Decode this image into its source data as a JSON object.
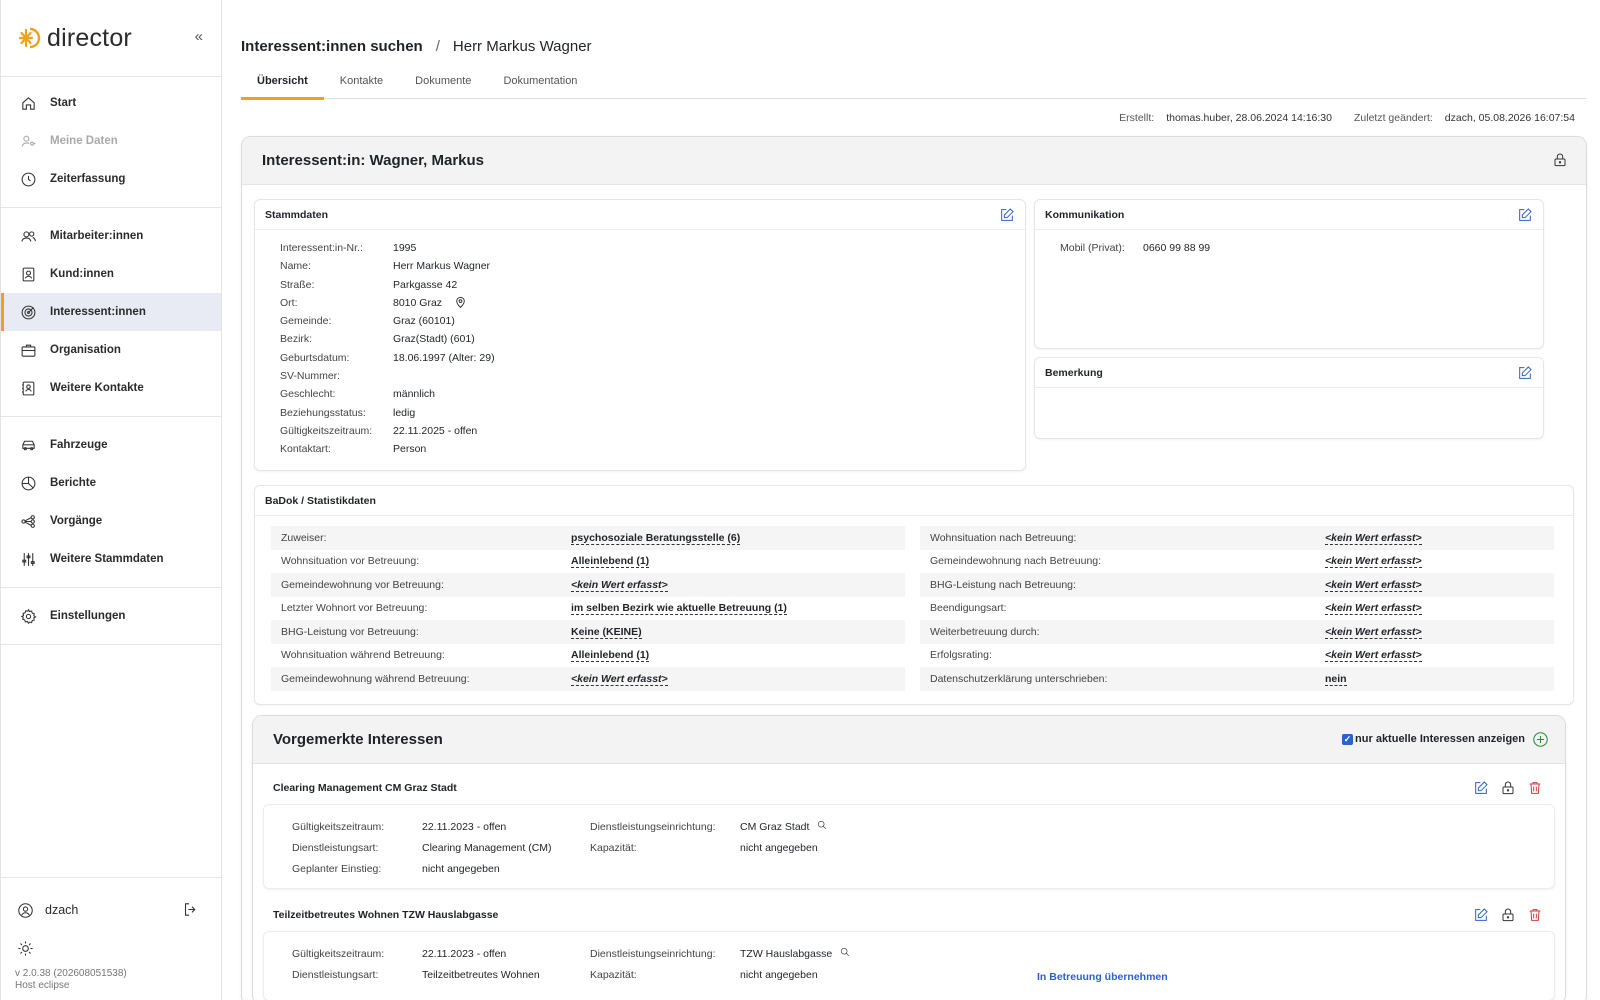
{
  "app": {
    "name": "director"
  },
  "sidebar": {
    "groups": [
      [
        {
          "label": "Start",
          "icon": "home-icon",
          "state": "normal"
        },
        {
          "label": "Meine Daten",
          "icon": "user-key-icon",
          "state": "disabled"
        },
        {
          "label": "Zeiterfassung",
          "icon": "clock-icon",
          "state": "normal"
        }
      ],
      [
        {
          "label": "Mitarbeiter:innen",
          "icon": "users-icon",
          "state": "normal"
        },
        {
          "label": "Kund:innen",
          "icon": "contact-card-icon",
          "state": "normal"
        },
        {
          "label": "Interessent:innen",
          "icon": "target-icon",
          "state": "active"
        },
        {
          "label": "Organisation",
          "icon": "briefcase-icon",
          "state": "normal"
        },
        {
          "label": "Weitere Kontakte",
          "icon": "address-book-icon",
          "state": "normal"
        }
      ],
      [
        {
          "label": "Fahrzeuge",
          "icon": "car-icon",
          "state": "normal"
        },
        {
          "label": "Berichte",
          "icon": "pie-chart-icon",
          "state": "normal"
        },
        {
          "label": "Vorgänge",
          "icon": "workflow-icon",
          "state": "normal"
        },
        {
          "label": "Weitere Stammdaten",
          "icon": "sliders-icon",
          "state": "normal"
        }
      ],
      [
        {
          "label": "Einstellungen",
          "icon": "gear-icon",
          "state": "normal"
        }
      ]
    ],
    "user": "dzach",
    "version": "v 2.0.38 (202608051538)",
    "host": "Host eclipse"
  },
  "breadcrumb": {
    "parent": "Interessent:innen suchen",
    "separator": "/",
    "current": "Herr Markus Wagner"
  },
  "tabs": [
    "Übersicht",
    "Kontakte",
    "Dokumente",
    "Dokumentation"
  ],
  "active_tab": 0,
  "meta": {
    "created_label": "Erstellt:",
    "created_value": "thomas.huber, 28.06.2024 14:16:30",
    "changed_label": "Zuletzt geändert:",
    "changed_value": "dzach, 05.08.2026 16:07:54"
  },
  "card_title": "Interessent:in: Wagner, Markus",
  "stammdaten": {
    "title": "Stammdaten",
    "rows": [
      {
        "k": "Interessent:in-Nr.:",
        "v": "1995"
      },
      {
        "k": "Name:",
        "v": "Herr Markus Wagner"
      },
      {
        "k": "Straße:",
        "v": "Parkgasse 42"
      },
      {
        "k": "Ort:",
        "v": "8010 Graz"
      },
      {
        "k": "Gemeinde:",
        "v": "Graz (60101)"
      },
      {
        "k": "Bezirk:",
        "v": "Graz(Stadt) (601)"
      },
      {
        "k": "Geburtsdatum:",
        "v": "18.06.1997 (Alter: 29)"
      },
      {
        "k": "SV-Nummer:",
        "v": ""
      },
      {
        "k": "Geschlecht:",
        "v": "männlich"
      },
      {
        "k": "Beziehungsstatus:",
        "v": "ledig"
      },
      {
        "k": "Gültigkeitszeitraum:",
        "v": "22.11.2025 - offen"
      },
      {
        "k": "Kontaktart:",
        "v": "Person"
      }
    ]
  },
  "kommunikation": {
    "title": "Kommunikation",
    "label": "Mobil (Privat):",
    "value": "0660 99 88 99"
  },
  "bemerkung": {
    "title": "Bemerkung"
  },
  "badok": {
    "title": "BaDok / Statistikdaten",
    "left": [
      {
        "k": "Zuweiser:",
        "v": "psychosoziale Beratungsstelle (6)",
        "empty": false
      },
      {
        "k": "Wohnsituation vor Betreuung:",
        "v": "Alleinlebend (1)",
        "empty": false
      },
      {
        "k": "Gemeindewohnung vor Betreuung:",
        "v": "<kein Wert erfasst>",
        "empty": true
      },
      {
        "k": "Letzter Wohnort vor Betreuung:",
        "v": "im selben Bezirk wie aktuelle Betreuung (1)",
        "empty": false
      },
      {
        "k": "BHG-Leistung vor Betreuung:",
        "v": "Keine (KEINE)",
        "empty": false
      },
      {
        "k": "Wohnsituation während Betreuung:",
        "v": "Alleinlebend (1)",
        "empty": false
      },
      {
        "k": "Gemeindewohnung während Betreuung:",
        "v": "<kein Wert erfasst>",
        "empty": true
      }
    ],
    "right": [
      {
        "k": "Wohnsituation nach Betreuung:",
        "v": "<kein Wert erfasst>",
        "empty": true
      },
      {
        "k": "Gemeindewohnung nach Betreuung:",
        "v": "<kein Wert erfasst>",
        "empty": true
      },
      {
        "k": "BHG-Leistung nach Betreuung:",
        "v": "<kein Wert erfasst>",
        "empty": true
      },
      {
        "k": "Beendigungsart:",
        "v": "<kein Wert erfasst>",
        "empty": true
      },
      {
        "k": "Weiterbetreuung durch:",
        "v": "<kein Wert erfasst>",
        "empty": true
      },
      {
        "k": "Erfolgsrating:",
        "v": "<kein Wert erfasst>",
        "empty": true
      },
      {
        "k": "Datenschutzerklärung unterschrieben:",
        "v": "nein",
        "empty": false
      }
    ]
  },
  "interessen": {
    "title": "Vorgemerkte Interessen",
    "checkbox_label": "nur aktuelle Interessen anzeigen",
    "items": [
      {
        "title": "Clearing Management CM Graz Stadt",
        "col1": [
          {
            "k": "Gültigkeitszeitraum:",
            "v": "22.11.2023 - offen"
          },
          {
            "k": "Dienstleistungsart:",
            "v": "Clearing Management (CM)"
          },
          {
            "k": "Geplanter Einstieg:",
            "v": "nicht angegeben"
          }
        ],
        "col2": [
          {
            "k": "Dienstleistungseinrichtung:",
            "v": "CM Graz Stadt"
          },
          {
            "k": "Kapazität:",
            "v": "nicht angegeben"
          }
        ],
        "link": ""
      },
      {
        "title": "Teilzeitbetreutes Wohnen TZW Hauslabgasse",
        "col1": [
          {
            "k": "Gültigkeitszeitraum:",
            "v": "22.11.2023 - offen"
          },
          {
            "k": "Dienstleistungsart:",
            "v": "Teilzeitbetreutes Wohnen"
          }
        ],
        "col2": [
          {
            "k": "Dienstleistungseinrichtung:",
            "v": "TZW Hauslabgasse"
          },
          {
            "k": "Kapazität:",
            "v": "nicht angegeben"
          }
        ],
        "link": "In Betreuung übernehmen"
      }
    ]
  },
  "colors": {
    "accent": "#f0a01e",
    "blue": "#2a63c9",
    "red": "#d23b3b",
    "green": "#2e8b3a",
    "active_bg": "#e8ebf3"
  }
}
